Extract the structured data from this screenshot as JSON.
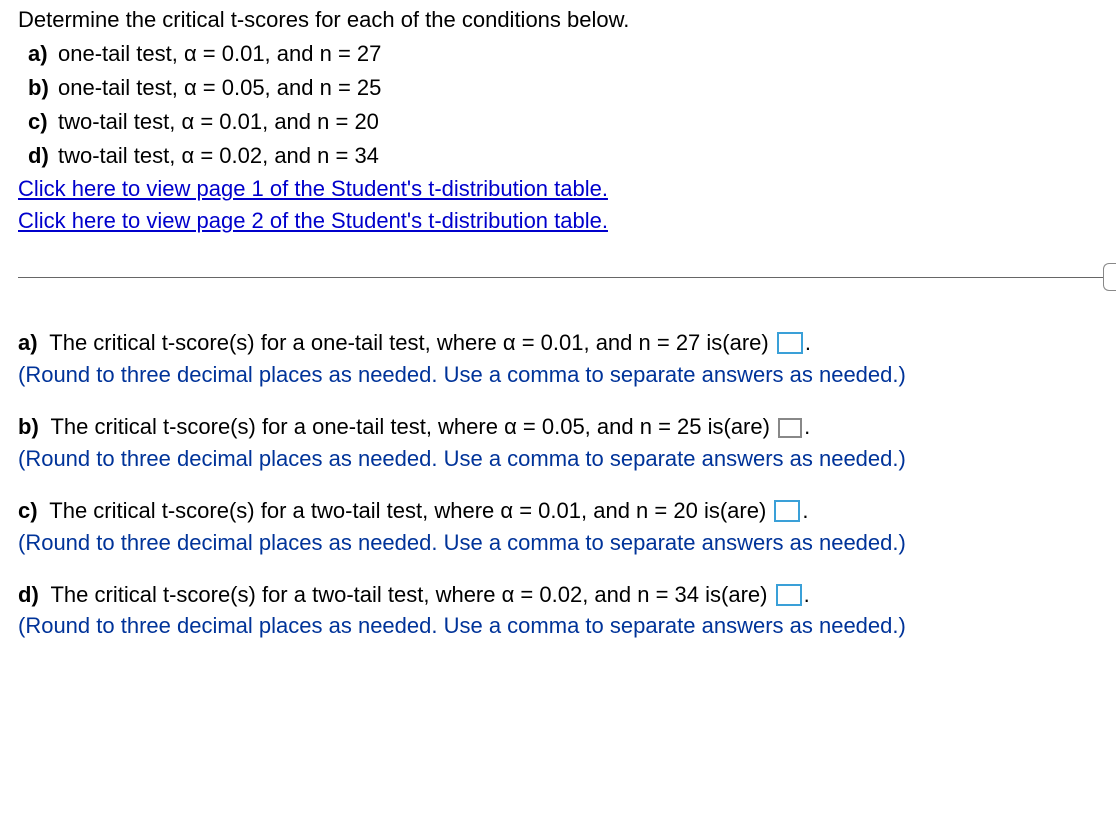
{
  "prompt": {
    "heading": "Determine the critical t-scores for each of the conditions below.",
    "items": {
      "a": {
        "label": "a)",
        "text": "one-tail test, α = 0.01, and n = 27"
      },
      "b": {
        "label": "b)",
        "text": "one-tail test, α = 0.05, and n = 25"
      },
      "c": {
        "label": "c)",
        "text": "two-tail test, α = 0.01, and n = 20"
      },
      "d": {
        "label": "d)",
        "text": "two-tail test, α = 0.02, and n = 34"
      }
    },
    "links": {
      "page1": "Click here to view page 1 of the Student's t-distribution table.",
      "page2": "Click here to view page 2 of the Student's t-distribution table."
    }
  },
  "answers": {
    "a": {
      "label": "a)",
      "pre": " The critical t-score(s) for a one-tail test, where α = 0.01, and n = 27 is(are) ",
      "post": ".",
      "instr": "(Round to three decimal places as needed. Use a comma to separate answers as needed.)"
    },
    "b": {
      "label": "b)",
      "pre": " The critical t-score(s) for a one-tail test, where α = 0.05, and n = 25 is(are) ",
      "post": ".",
      "instr": "(Round to three decimal places as needed. Use a comma to separate answers as needed.)"
    },
    "c": {
      "label": "c)",
      "pre": " The critical t-score(s) for a two-tail test, where α = 0.01, and n = 20 is(are) ",
      "post": ".",
      "instr": "(Round to three decimal places as needed. Use a comma to separate answers as needed.)"
    },
    "d": {
      "label": "d)",
      "pre": " The critical t-score(s) for a two-tail test, where α = 0.02, and n = 34 is(are) ",
      "post": ".",
      "instr": "(Round to three decimal places as needed. Use a comma to separate answers as needed.)"
    }
  }
}
